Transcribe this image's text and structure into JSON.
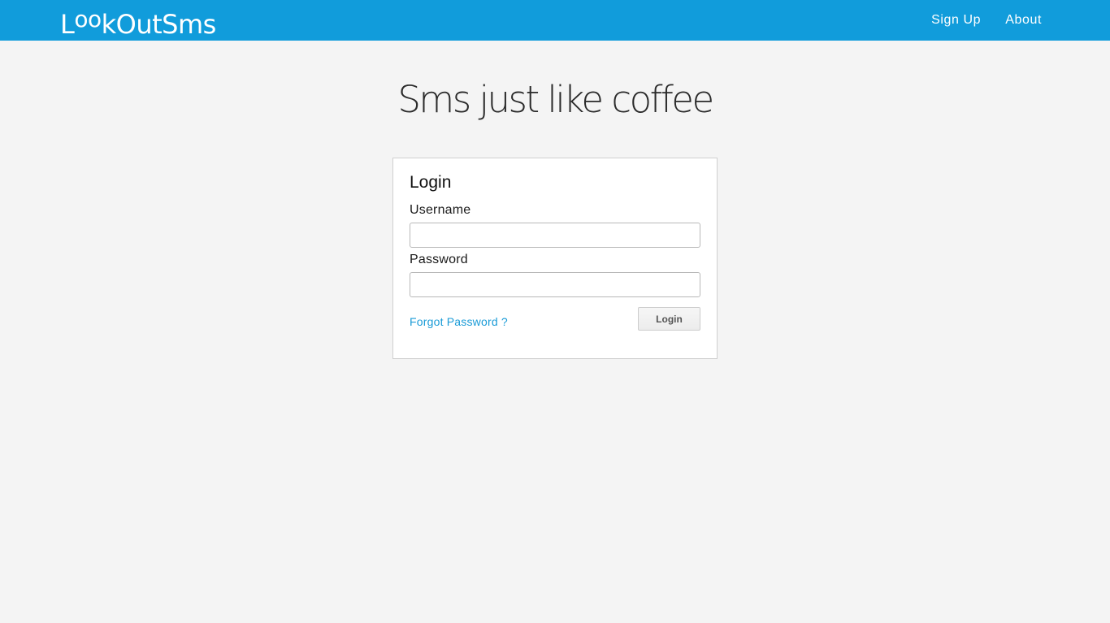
{
  "navbar": {
    "brand": {
      "parts": [
        "L",
        "oo",
        "kOutSms"
      ],
      "text": "LookOutSms"
    },
    "links": [
      {
        "label": "Sign Up"
      },
      {
        "label": "About"
      }
    ],
    "background_color": "#119cdb"
  },
  "headline": "Sms just like coffee",
  "login_panel": {
    "title": "Login",
    "username_label": "Username",
    "username_value": "",
    "password_label": "Password",
    "password_value": "",
    "forgot_link": "Forgot Password ?",
    "submit_label": "Login",
    "link_color": "#1a9bd7"
  }
}
